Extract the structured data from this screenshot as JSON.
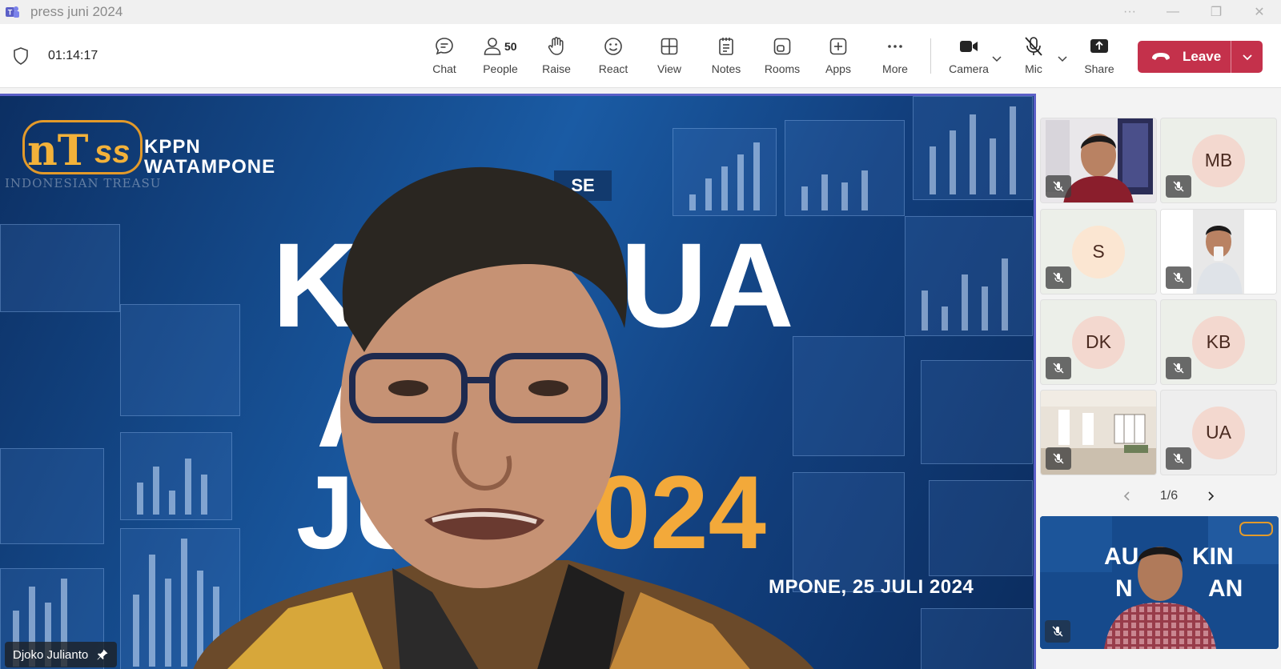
{
  "window": {
    "title": "press juni 2024",
    "app_icon": "teams-icon",
    "controls": [
      "more-options-icon",
      "minimize-icon",
      "maximize-icon",
      "close-icon"
    ]
  },
  "meeting": {
    "timer": "01:14:17",
    "toolbar": [
      {
        "key": "chat",
        "label": "Chat",
        "icon": "chat-icon"
      },
      {
        "key": "people",
        "label": "People",
        "icon": "people-icon",
        "count": "50"
      },
      {
        "key": "raise",
        "label": "Raise",
        "icon": "hand-icon"
      },
      {
        "key": "react",
        "label": "React",
        "icon": "smiley-icon"
      },
      {
        "key": "view",
        "label": "View",
        "icon": "grid-icon"
      },
      {
        "key": "notes",
        "label": "Notes",
        "icon": "notes-icon"
      },
      {
        "key": "rooms",
        "label": "Rooms",
        "icon": "rooms-icon"
      },
      {
        "key": "apps",
        "label": "Apps",
        "icon": "plus-icon"
      },
      {
        "key": "more",
        "label": "More",
        "icon": "ellipsis-icon"
      },
      {
        "key": "camera",
        "label": "Camera",
        "icon": "camera-icon"
      },
      {
        "key": "mic",
        "label": "Mic",
        "icon": "mic-off-icon"
      },
      {
        "key": "share",
        "label": "Share",
        "icon": "share-icon"
      }
    ],
    "leave_label": "Leave",
    "colors": {
      "leave": "#c4314b",
      "accent": "#5b5fc7"
    }
  },
  "stage": {
    "speaker_name": "Djoko Julianto",
    "backdrop": {
      "org_line1": "KPPN",
      "org_line2": "WATAMPONE",
      "tagline": "INDONESIAN TREASU",
      "se_tag": "SE",
      "big_k": "K",
      "big_ua": "UA",
      "big_an": "A  N",
      "big_ju": "JU",
      "big_year": "024",
      "date_line": "MPONE, 25 JULI 2024"
    }
  },
  "gallery": {
    "tiles": [
      {
        "type": "video",
        "initials": ""
      },
      {
        "type": "avatar",
        "initials": "MB",
        "color": "#f3d8cf"
      },
      {
        "type": "avatar",
        "initials": "S",
        "color": "#fbe6d2"
      },
      {
        "type": "video",
        "initials": ""
      },
      {
        "type": "avatar",
        "initials": "DK",
        "color": "#f3d8cf"
      },
      {
        "type": "avatar",
        "initials": "KB",
        "color": "#f3d8cf"
      },
      {
        "type": "video",
        "initials": ""
      },
      {
        "type": "avatar",
        "initials": "UA",
        "color": "#f3d8cf"
      }
    ],
    "pager": "1/6"
  }
}
